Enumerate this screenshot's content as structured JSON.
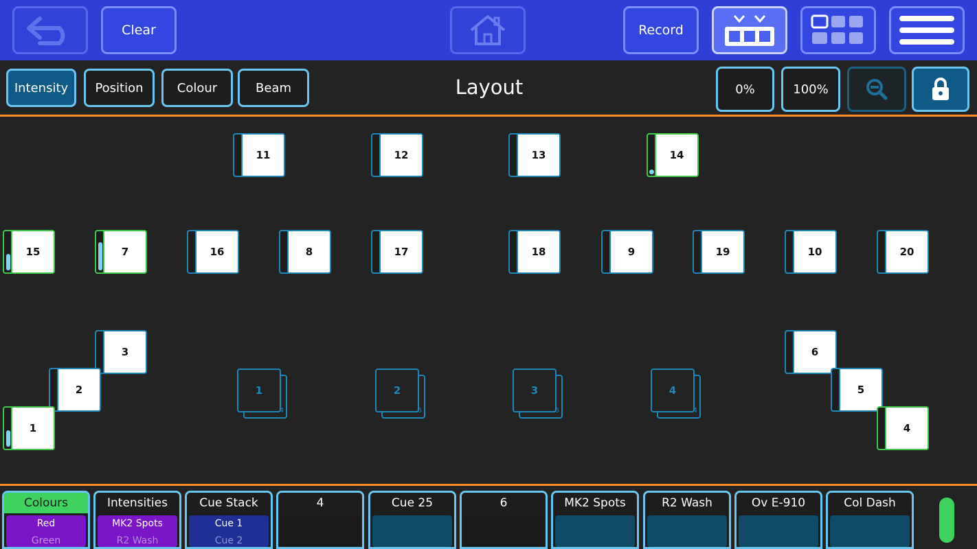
{
  "topbar": {
    "clear_label": "Clear",
    "record_label": "Record"
  },
  "subbar": {
    "tabs": [
      {
        "label": "Intensity",
        "selected": true
      },
      {
        "label": "Position",
        "selected": false
      },
      {
        "label": "Colour",
        "selected": false
      },
      {
        "label": "Beam",
        "selected": false
      }
    ],
    "title": "Layout",
    "zero_label": "0%",
    "full_label": "100%"
  },
  "fixtures": [
    {
      "id": "11",
      "on": false,
      "level": 0
    },
    {
      "id": "12",
      "on": false,
      "level": 0
    },
    {
      "id": "13",
      "on": false,
      "level": 0
    },
    {
      "id": "14",
      "on": true,
      "level": 0.05
    },
    {
      "id": "15",
      "on": true,
      "level": 0.45
    },
    {
      "id": "7",
      "on": true,
      "level": 0.75
    },
    {
      "id": "16",
      "on": false,
      "level": 0
    },
    {
      "id": "8",
      "on": false,
      "level": 0
    },
    {
      "id": "17",
      "on": false,
      "level": 0
    },
    {
      "id": "18",
      "on": false,
      "level": 0
    },
    {
      "id": "9",
      "on": false,
      "level": 0
    },
    {
      "id": "19",
      "on": false,
      "level": 0
    },
    {
      "id": "10",
      "on": false,
      "level": 0
    },
    {
      "id": "20",
      "on": false,
      "level": 0
    },
    {
      "id": "3",
      "on": false,
      "level": 0
    },
    {
      "id": "2",
      "on": false,
      "level": 0
    },
    {
      "id": "1",
      "on": true,
      "level": 0.45
    },
    {
      "id": "6",
      "on": false,
      "level": 0
    },
    {
      "id": "5",
      "on": false,
      "level": 0
    },
    {
      "id": "4",
      "on": true,
      "level": 0
    }
  ],
  "groups": [
    {
      "id": "1",
      "count": "4"
    },
    {
      "id": "2",
      "count": "6"
    },
    {
      "id": "3",
      "count": "6"
    },
    {
      "id": "4",
      "count": "4"
    }
  ],
  "playbacks": [
    {
      "title": "Colours",
      "active": true,
      "style": "purple",
      "line1": "Red",
      "line2": "Green"
    },
    {
      "title": "Intensities",
      "active": false,
      "style": "purple",
      "line1": "MK2 Spots",
      "line2": "R2 Wash"
    },
    {
      "title": "Cue Stack",
      "active": false,
      "style": "navy",
      "line1": "Cue 1",
      "line2": "Cue 2"
    },
    {
      "title": "4",
      "active": false,
      "style": "empty",
      "line1": "",
      "line2": ""
    },
    {
      "title": "Cue 25",
      "active": false,
      "style": "teal",
      "line1": "",
      "line2": ""
    },
    {
      "title": "6",
      "active": false,
      "style": "empty",
      "line1": "",
      "line2": ""
    },
    {
      "title": "MK2 Spots",
      "active": false,
      "style": "teal",
      "line1": "",
      "line2": ""
    },
    {
      "title": "R2 Wash",
      "active": false,
      "style": "teal",
      "line1": "",
      "line2": ""
    },
    {
      "title": "Ov E-910",
      "active": false,
      "style": "teal",
      "line1": "",
      "line2": ""
    },
    {
      "title": "Col Dash",
      "active": false,
      "style": "teal",
      "line1": "",
      "line2": ""
    }
  ],
  "colors": {
    "topbar": "#2f3fd6",
    "accent": "#69c6ef",
    "fixture_border": "#1f87b8",
    "active_green": "#3fc84a",
    "separator": "#ff8c2a"
  }
}
